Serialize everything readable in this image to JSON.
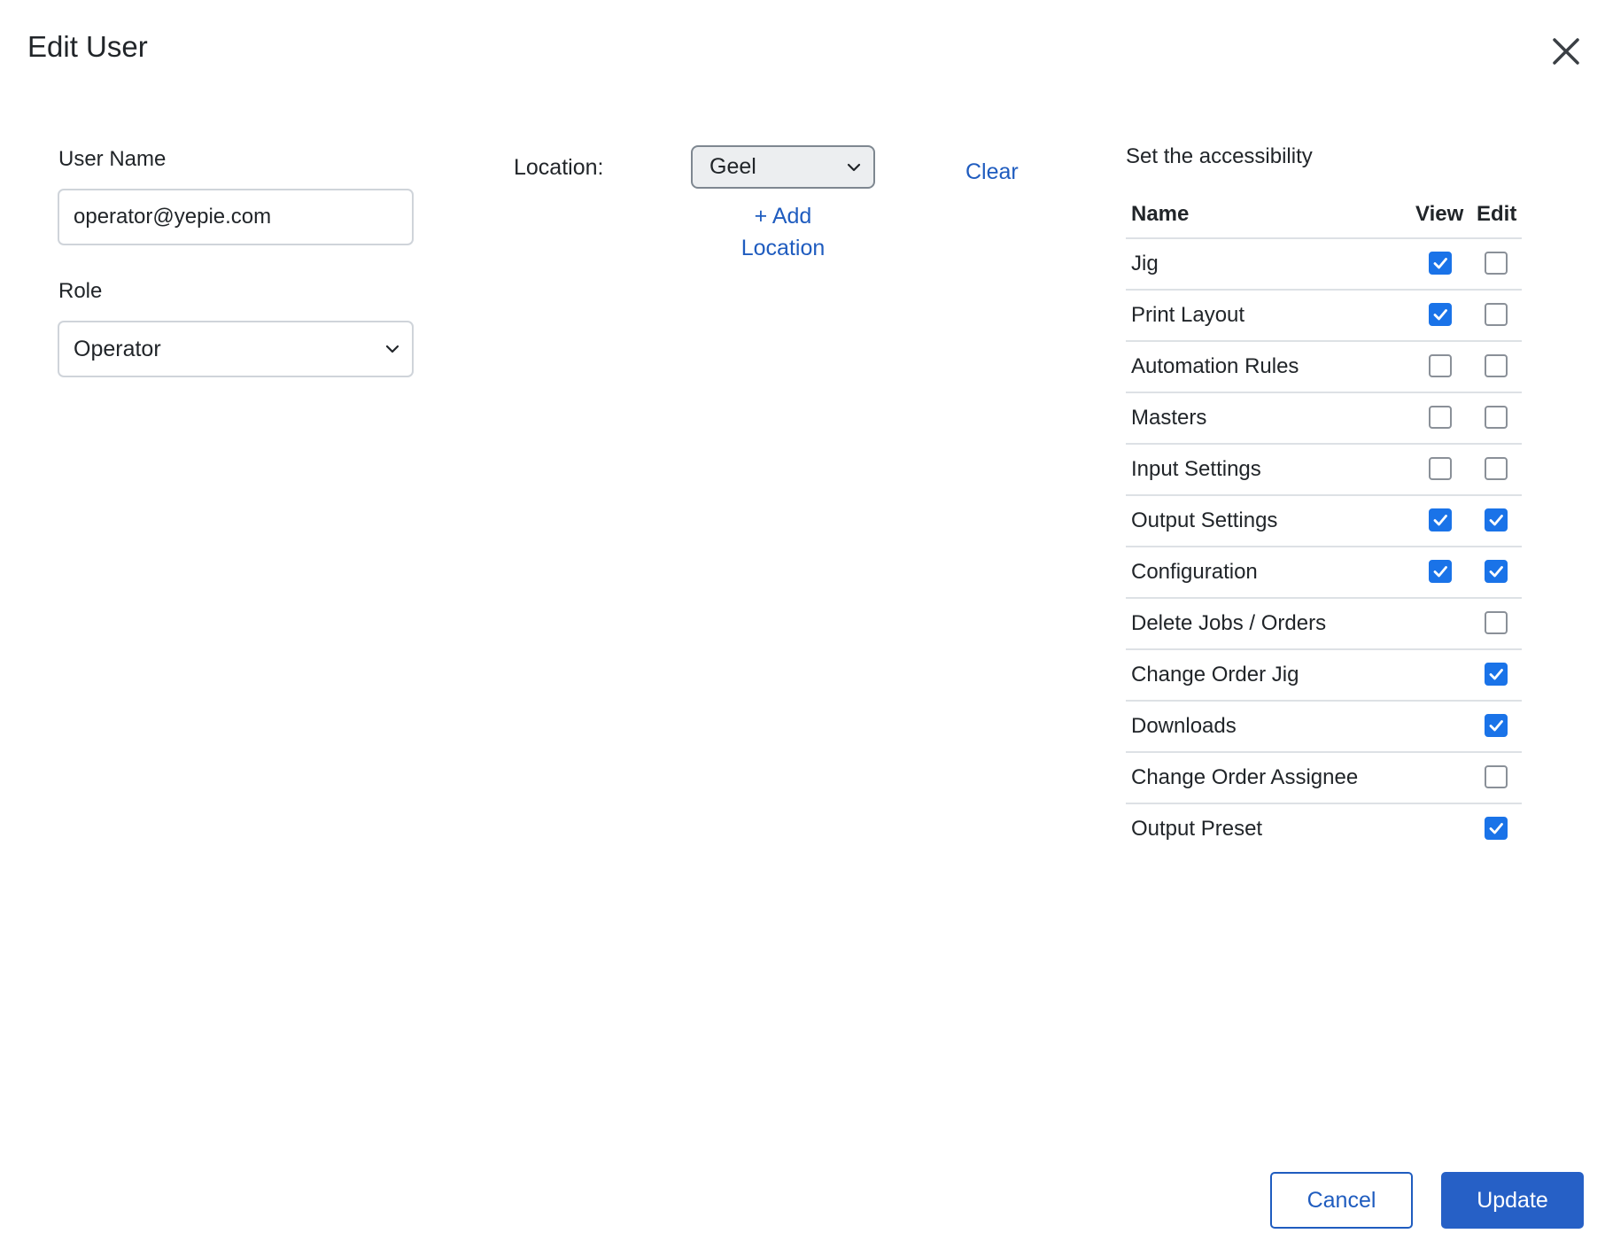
{
  "modal": {
    "title": "Edit User"
  },
  "form": {
    "username_label": "User Name",
    "username_value": "operator@yepie.com",
    "role_label": "Role",
    "role_value": "Operator"
  },
  "location": {
    "label": "Location:",
    "value": "Geel",
    "clear_label": "Clear",
    "add_label_line1": "+ Add",
    "add_label_line2": "Location"
  },
  "permissions": {
    "title": "Set the accessibility",
    "headers": {
      "name": "Name",
      "view": "View",
      "edit": "Edit"
    },
    "rows": [
      {
        "name": "Jig",
        "view": true,
        "edit": false
      },
      {
        "name": "Print Layout",
        "view": true,
        "edit": false
      },
      {
        "name": "Automation Rules",
        "view": false,
        "edit": false
      },
      {
        "name": "Masters",
        "view": false,
        "edit": false
      },
      {
        "name": "Input Settings",
        "view": false,
        "edit": false
      },
      {
        "name": "Output Settings",
        "view": true,
        "edit": true
      },
      {
        "name": "Configuration",
        "view": true,
        "edit": true
      },
      {
        "name": "Delete Jobs / Orders",
        "view": null,
        "edit": false
      },
      {
        "name": "Change Order Jig",
        "view": null,
        "edit": true
      },
      {
        "name": "Downloads",
        "view": null,
        "edit": true
      },
      {
        "name": "Change Order Assignee",
        "view": null,
        "edit": false
      },
      {
        "name": "Output Preset",
        "view": null,
        "edit": true
      }
    ]
  },
  "footer": {
    "cancel_label": "Cancel",
    "update_label": "Update"
  },
  "colors": {
    "accent": "#1f5cbf",
    "checkbox_checked": "#1a73e8",
    "primary_button": "#2660c6"
  },
  "icons": {
    "close": "close-icon",
    "chevron": "chevron-down-icon",
    "check": "check-icon"
  }
}
